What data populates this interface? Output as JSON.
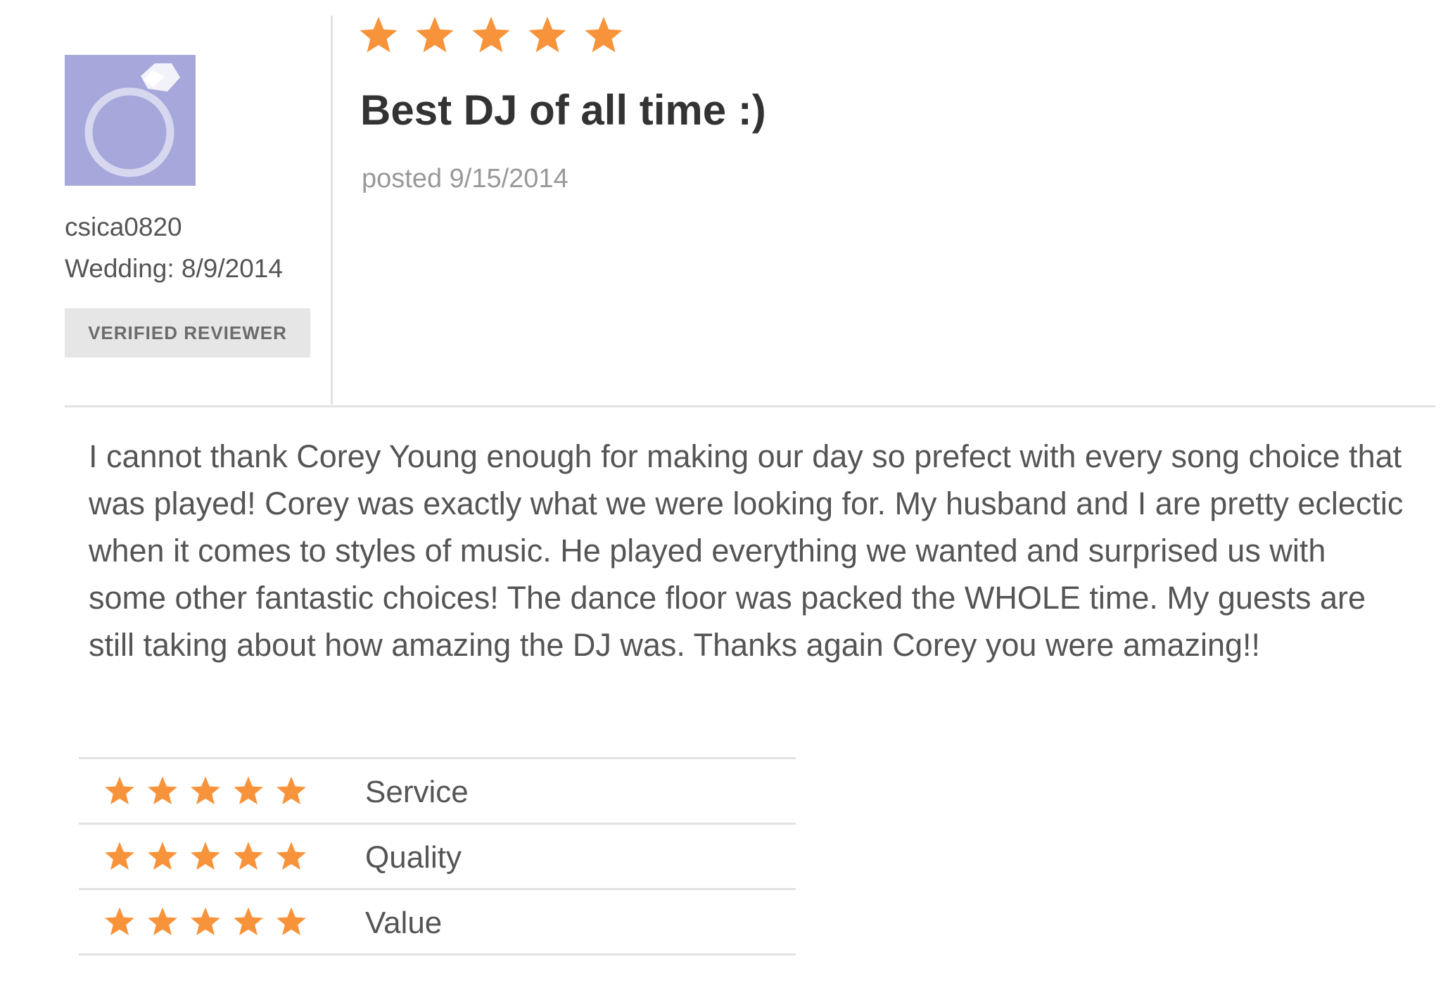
{
  "reviewer": {
    "avatar_icon": "ring-icon",
    "username": "csica0820",
    "wedding": "Wedding: 8/9/2014",
    "badge": "VERIFIED REVIEWER"
  },
  "review": {
    "overall_rating": 5,
    "overall_rating_max": 5,
    "title": "Best DJ of all time :)",
    "posted": "posted 9/15/2014",
    "body": "I cannot thank Corey Young enough for making our day so prefect with every song choice that was played! Corey was exactly what we were looking for. My husband and I are pretty eclectic when it comes to styles of music. He played everything we wanted and surprised us with some other fantastic choices! The dance floor was packed the WHOLE time. My guests are still taking about how amazing the DJ was. Thanks again Corey you were amazing!!"
  },
  "ratings": [
    {
      "label": "Service",
      "value": 5,
      "max": 5
    },
    {
      "label": "Quality",
      "value": 5,
      "max": 5
    },
    {
      "label": "Value",
      "value": 5,
      "max": 5
    }
  ],
  "colors": {
    "star": "#f7943b",
    "avatar_bg": "#a6a8db",
    "divider": "#e2e2e2"
  }
}
